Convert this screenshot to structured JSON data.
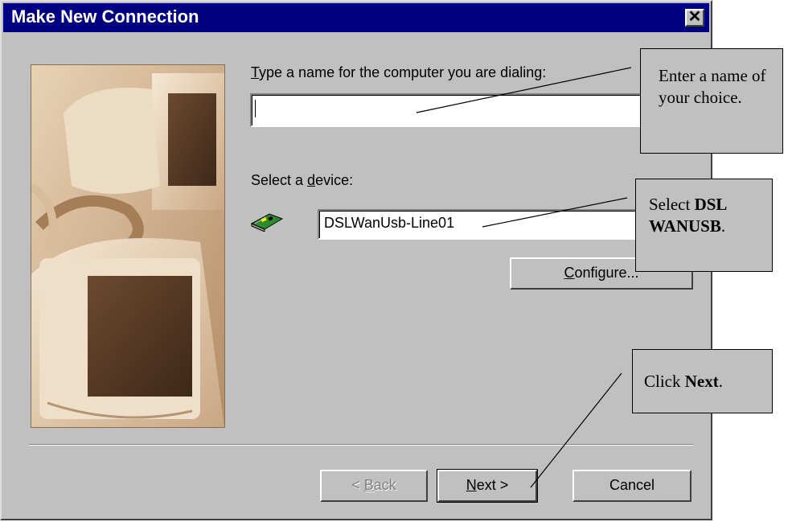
{
  "window": {
    "title": "Make New Connection",
    "close_label": "✕"
  },
  "name_section": {
    "label_accel": "T",
    "label_rest": "ype a name for the computer you are dialing:",
    "value": ""
  },
  "device_section": {
    "label_pre": "Select a ",
    "label_accel": "d",
    "label_post": "evice:",
    "selected_device": "DSLWanUsb-Line01",
    "icon": "modem-card-icon"
  },
  "buttons": {
    "configure_accel": "C",
    "configure_rest": "onfigure...",
    "back_pre": "< ",
    "back_accel": "B",
    "back_rest": "ack",
    "next_accel": "N",
    "next_rest": "ext >",
    "cancel": "Cancel"
  },
  "callouts": {
    "name": "Enter a name of your choice.",
    "device_pre": "Select ",
    "device_bold": "DSL WANUSB",
    "device_post": ".",
    "next_pre": "Click ",
    "next_bold": "Next",
    "next_post": "."
  },
  "colors": {
    "titlebar": "#000080",
    "dialog": "#c0c0c0",
    "illustration": "#c9a783"
  }
}
